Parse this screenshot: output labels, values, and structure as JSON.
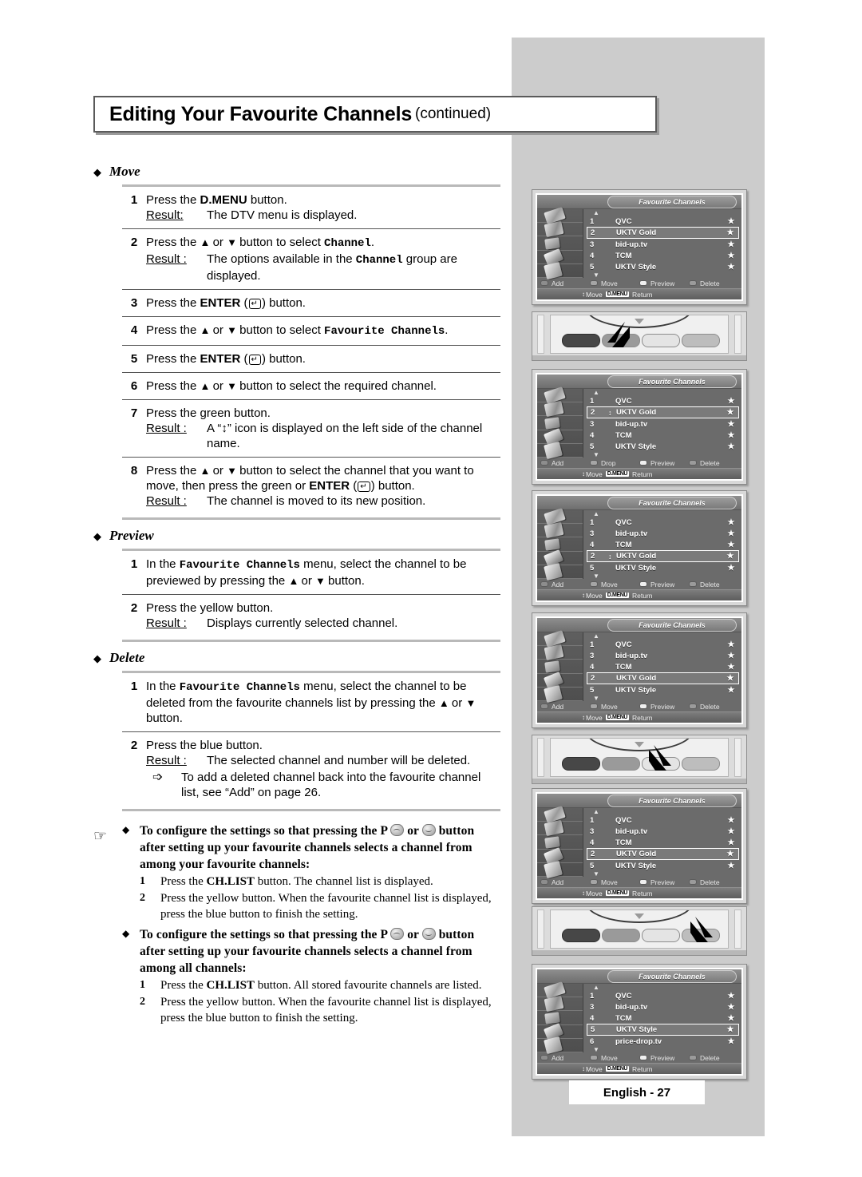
{
  "header": {
    "title": "Editing Your Favourite Channels",
    "continued": "(continued)"
  },
  "sections": [
    {
      "label": "Move",
      "steps": [
        {
          "num": "1",
          "lines": [
            "Press the D.MENU button."
          ],
          "result_label": "Result:",
          "result": "The DTV menu is displayed."
        },
        {
          "num": "2",
          "lines": [
            "Press the ▲ or ▼ button to select Channel."
          ],
          "result_label": "Result :",
          "result": "The options available in the Channel group are displayed."
        },
        {
          "num": "3",
          "lines": [
            "Press the ENTER ( ) button."
          ]
        },
        {
          "num": "4",
          "lines": [
            "Press the ▲ or ▼ button to select Favourite Channels."
          ]
        },
        {
          "num": "5",
          "lines": [
            "Press the ENTER ( ) button."
          ]
        },
        {
          "num": "6",
          "lines": [
            "Press the ▲ or ▼ button to select the required channel."
          ]
        },
        {
          "num": "7",
          "lines": [
            "Press the green button."
          ],
          "result_label": "Result :",
          "result": "A “↕” icon is displayed on the left side of the channel name."
        },
        {
          "num": "8",
          "lines": [
            "Press the ▲ or ▼ button to select the channel that you want to move, then press the green or ENTER ( ) button."
          ],
          "result_label": "Result :",
          "result": "The channel is moved to its new position."
        }
      ]
    },
    {
      "label": "Preview",
      "steps": [
        {
          "num": "1",
          "lines": [
            "In the Favourite Channels menu, select the channel to be previewed by pressing the ▲ or ▼ button."
          ]
        },
        {
          "num": "2",
          "lines": [
            "Press the yellow button."
          ],
          "result_label": "Result :",
          "result": "Displays currently selected channel."
        }
      ]
    },
    {
      "label": "Delete",
      "steps": [
        {
          "num": "1",
          "lines": [
            "In the Favourite Channels menu, select the channel to be deleted from the favourite channels list by pressing the ▲ or ▼ button."
          ]
        },
        {
          "num": "2",
          "lines": [
            "Press the blue button."
          ],
          "result_label": "Result :",
          "result": "The selected channel and number will be deleted.",
          "tip": "To add a deleted channel back into the favourite channel list, see “Add” on page 26."
        }
      ]
    }
  ],
  "notes": [
    {
      "heading_parts": [
        "To configure the settings so that pressing the P ",
        " or ",
        " button after setting up your favourite channels selects a channel from among your favourite channels:"
      ],
      "steps": [
        {
          "num": "1",
          "text": "Press the CH.LIST button. The channel list is displayed."
        },
        {
          "num": "2",
          "text": "Press the yellow button. When the favourite channel list is displayed, press the blue button to finish the setting."
        }
      ]
    },
    {
      "heading_parts": [
        "To configure the settings so that pressing the P ",
        " or ",
        " button after setting up your favourite channels selects a channel from among all channels:"
      ],
      "steps": [
        {
          "num": "1",
          "text": "Press the CH.LIST button. All stored favourite channels are listed."
        },
        {
          "num": "2",
          "text": "Press the yellow button. When the favourite channel list is displayed, press the blue button to finish the setting."
        }
      ]
    }
  ],
  "osd": {
    "title": "Favourite Channels",
    "footer_actions": [
      "Add",
      "Move",
      "Preview",
      "Delete"
    ],
    "footer_actions_drop": [
      "Add",
      "Drop",
      "Preview",
      "Delete"
    ],
    "navbar": {
      "move": "Move",
      "dmenu": "D.MENU",
      "return": "Return"
    },
    "star": "★",
    "move_icon": "↕",
    "up_arrow": "▲",
    "down_arrow": "▼",
    "screens": [
      {
        "id": "screen-1",
        "actions": [
          "Add",
          "Move",
          "Preview",
          "Delete"
        ],
        "rows": [
          {
            "no": "1",
            "name": "QVC",
            "selected": false,
            "move": false
          },
          {
            "no": "2",
            "name": "UKTV Gold",
            "selected": true,
            "move": false
          },
          {
            "no": "3",
            "name": "bid-up.tv",
            "selected": false,
            "move": false
          },
          {
            "no": "4",
            "name": "TCM",
            "selected": false,
            "move": false
          },
          {
            "no": "5",
            "name": "UKTV Style",
            "selected": false,
            "move": false
          }
        ]
      },
      {
        "id": "screen-2",
        "actions": [
          "Add",
          "Drop",
          "Preview",
          "Delete"
        ],
        "rows": [
          {
            "no": "1",
            "name": "QVC",
            "selected": false,
            "move": false
          },
          {
            "no": "2",
            "name": "UKTV Gold",
            "selected": true,
            "move": true
          },
          {
            "no": "3",
            "name": "bid-up.tv",
            "selected": false,
            "move": false
          },
          {
            "no": "4",
            "name": "TCM",
            "selected": false,
            "move": false
          },
          {
            "no": "5",
            "name": "UKTV Style",
            "selected": false,
            "move": false
          }
        ]
      },
      {
        "id": "screen-3",
        "actions": [
          "Add",
          "Move",
          "Preview",
          "Delete"
        ],
        "rows": [
          {
            "no": "1",
            "name": "QVC",
            "selected": false,
            "move": false
          },
          {
            "no": "3",
            "name": "bid-up.tv",
            "selected": false,
            "move": false
          },
          {
            "no": "4",
            "name": "TCM",
            "selected": false,
            "move": false
          },
          {
            "no": "2",
            "name": "UKTV Gold",
            "selected": true,
            "move": true
          },
          {
            "no": "5",
            "name": "UKTV Style",
            "selected": false,
            "move": false
          }
        ]
      },
      {
        "id": "screen-4",
        "actions": [
          "Add",
          "Move",
          "Preview",
          "Delete"
        ],
        "rows": [
          {
            "no": "1",
            "name": "QVC",
            "selected": false,
            "move": false
          },
          {
            "no": "3",
            "name": "bid-up.tv",
            "selected": false,
            "move": false
          },
          {
            "no": "4",
            "name": "TCM",
            "selected": false,
            "move": false
          },
          {
            "no": "2",
            "name": "UKTV Gold",
            "selected": true,
            "move": false
          },
          {
            "no": "5",
            "name": "UKTV Style",
            "selected": false,
            "move": false
          }
        ]
      },
      {
        "id": "screen-5",
        "actions": [
          "Add",
          "Move",
          "Preview",
          "Delete"
        ],
        "rows": [
          {
            "no": "1",
            "name": "QVC",
            "selected": false,
            "move": false
          },
          {
            "no": "3",
            "name": "bid-up.tv",
            "selected": false,
            "move": false
          },
          {
            "no": "4",
            "name": "TCM",
            "selected": false,
            "move": false
          },
          {
            "no": "2",
            "name": "UKTV Gold",
            "selected": true,
            "move": false
          },
          {
            "no": "5",
            "name": "UKTV Style",
            "selected": false,
            "move": false
          }
        ]
      },
      {
        "id": "screen-6",
        "actions": [
          "Add",
          "Move",
          "Preview",
          "Delete"
        ],
        "rows": [
          {
            "no": "1",
            "name": "QVC",
            "selected": false,
            "move": false
          },
          {
            "no": "3",
            "name": "bid-up.tv",
            "selected": false,
            "move": false
          },
          {
            "no": "4",
            "name": "TCM",
            "selected": false,
            "move": false
          },
          {
            "no": "5",
            "name": "UKTV Style",
            "selected": true,
            "move": false
          },
          {
            "no": "6",
            "name": "price-drop.tv",
            "selected": false,
            "move": false
          }
        ]
      }
    ]
  },
  "remotes": [
    {
      "id": "remote-green",
      "highlight": 1
    },
    {
      "id": "remote-yellow",
      "highlight": 2
    },
    {
      "id": "remote-blue",
      "highlight": 3
    }
  ],
  "footer": {
    "page_label": "English - 27"
  }
}
